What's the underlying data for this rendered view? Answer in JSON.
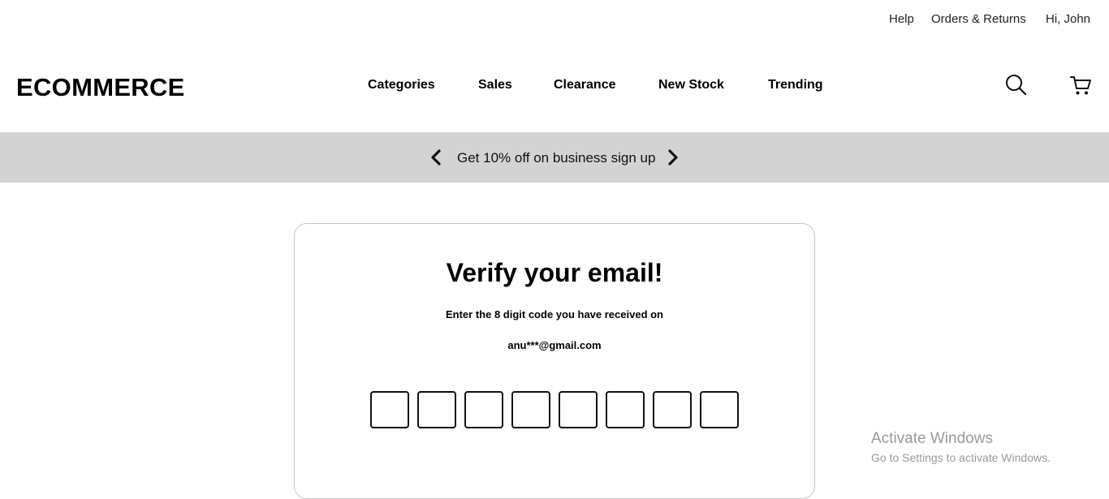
{
  "top_links": {
    "help": "Help",
    "orders_returns": "Orders & Returns",
    "greeting": "Hi, John"
  },
  "header": {
    "logo": "ECOMMERCE",
    "nav": [
      "Categories",
      "Sales",
      "Clearance",
      "New Stock",
      "Trending"
    ],
    "icons": [
      "search-icon",
      "cart-icon"
    ]
  },
  "promo": {
    "text": "Get 10% off on business sign up",
    "icons": [
      "chevron-left-icon",
      "chevron-right-icon"
    ],
    "background": "#d3d3d3"
  },
  "verify": {
    "title": "Verify your email!",
    "subtitle": "Enter the 8 digit code you have received on",
    "email": "anu***@gmail.com",
    "code_length": 8
  },
  "watermark": {
    "title": "Activate Windows",
    "subtitle": "Go to Settings to activate Windows."
  }
}
